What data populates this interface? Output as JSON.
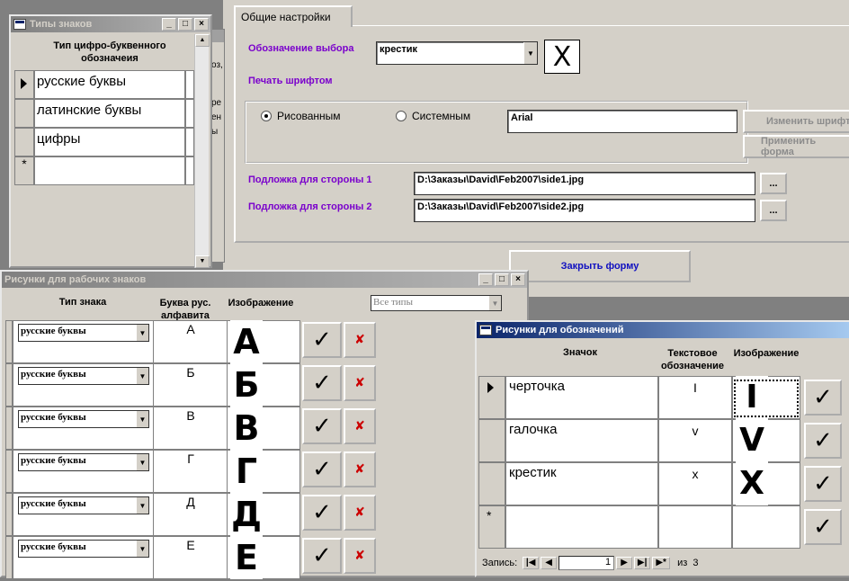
{
  "settings": {
    "tab_label": "Общие настройки",
    "selection_label": "Обозначение выбора",
    "selection_value": "крестик",
    "selection_preview": "X",
    "print_font_label": "Печать шрифтом",
    "radio_drawn": "Рисованным",
    "radio_system": "Системным",
    "font_value": "Arial",
    "change_font_button": "Изменить шрифт",
    "apply_format_button": "Применить форма",
    "bg1_label": "Подложка для стороны 1",
    "bg1_value": "D:\\Заказы\\David\\Feb2007\\side1.jpg",
    "bg2_label": "Подложка для стороны 2",
    "bg2_value": "D:\\Заказы\\David\\Feb2007\\side2.jpg",
    "browse_label": "...",
    "close_form_button": "Закрыть форму"
  },
  "types_window": {
    "title": "Типы знаков",
    "column_header": "Тип цифро-буквенного обозначеия",
    "rows": [
      "русские буквы",
      "латинские буквы",
      "цифры"
    ],
    "new_row_marker": "*"
  },
  "behind_fragments": [
    "оз,",
    "ре",
    "ен",
    "ы"
  ],
  "images_window": {
    "title": "Рисунки для рабочих знаков",
    "col_type": "Тип знака",
    "col_letter": "Буква рус. алфавита",
    "col_image": "Изображение",
    "filter_value": "Все типы",
    "rows": [
      {
        "type": "русские буквы",
        "letter": "А",
        "image": "А"
      },
      {
        "type": "русские буквы",
        "letter": "Б",
        "image": "Б"
      },
      {
        "type": "русские буквы",
        "letter": "В",
        "image": "В"
      },
      {
        "type": "русские буквы",
        "letter": "Г",
        "image": "Г"
      },
      {
        "type": "русские буквы",
        "letter": "Д",
        "image": "Д"
      },
      {
        "type": "русские буквы",
        "letter": "Е",
        "image": "Е"
      }
    ]
  },
  "marks_window": {
    "title": "Рисунки для обозначений",
    "col_icon": "Значок",
    "col_text": "Текстовое обозначение",
    "col_image": "Изображение",
    "rows": [
      {
        "name": "черточка",
        "text": "I",
        "image": "I"
      },
      {
        "name": "галочка",
        "text": "v",
        "image": "V"
      },
      {
        "name": "крестик",
        "text": "x",
        "image": "X"
      }
    ],
    "new_row_marker": "*",
    "nav_label": "Запись:",
    "nav_record": "1",
    "nav_of": "из",
    "nav_total": "3"
  },
  "icons": [
    "check-icon",
    "delete-icon",
    "record-selector-icon",
    "new-record-icon"
  ]
}
